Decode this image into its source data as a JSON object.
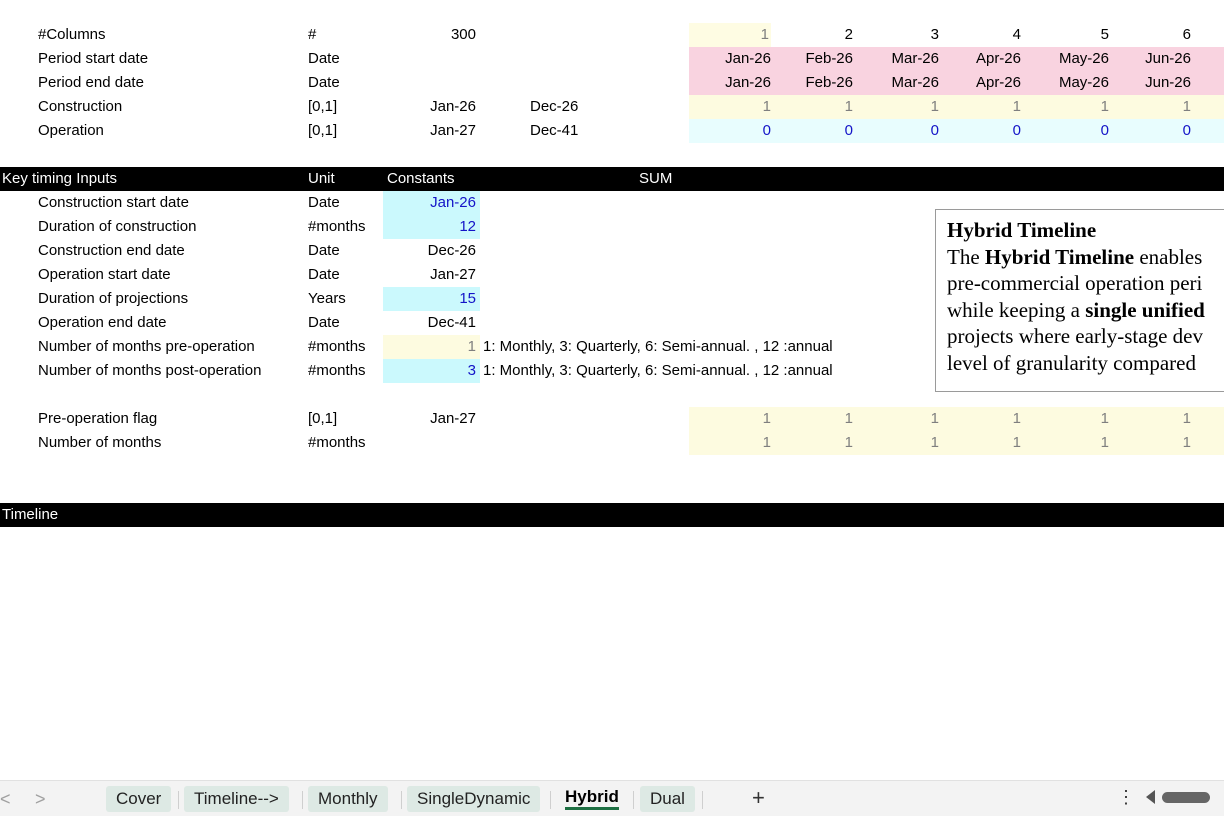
{
  "timeline_rows": [
    {
      "label": "#Columns",
      "unit": "#",
      "constant": "300",
      "start": "",
      "end": "",
      "cells": [
        "1",
        "2",
        "3",
        "4",
        "5",
        "6"
      ]
    },
    {
      "label": "Period start date",
      "unit": "Date",
      "constant": "",
      "start": "",
      "end": "",
      "cells": [
        "Jan-26",
        "Feb-26",
        "Mar-26",
        "Apr-26",
        "May-26",
        "Jun-26"
      ]
    },
    {
      "label": "Period end date",
      "unit": "Date",
      "constant": "",
      "start": "",
      "end": "",
      "cells": [
        "Jan-26",
        "Feb-26",
        "Mar-26",
        "Apr-26",
        "May-26",
        "Jun-26"
      ]
    },
    {
      "label": "Construction",
      "unit": "[0,1]",
      "constant": "Jan-26",
      "start": "Dec-26",
      "end": "",
      "cells": [
        "1",
        "1",
        "1",
        "1",
        "1",
        "1"
      ]
    },
    {
      "label": "Operation",
      "unit": "[0,1]",
      "constant": "Jan-27",
      "start": "Dec-41",
      "end": "",
      "cells": [
        "0",
        "0",
        "0",
        "0",
        "0",
        "0"
      ]
    }
  ],
  "key_timing_header": {
    "title": "Key timing Inputs",
    "unit": "Unit",
    "constants": "Constants",
    "sum": "SUM"
  },
  "key_timing_rows": [
    {
      "label": "Construction start date",
      "unit": "Date",
      "value": "Jan-26",
      "note": ""
    },
    {
      "label": "Duration of construction",
      "unit": "#months",
      "value": "12",
      "note": ""
    },
    {
      "label": "Construction end date",
      "unit": "Date",
      "value": "Dec-26",
      "note": ""
    },
    {
      "label": "Operation start date",
      "unit": "Date",
      "value": "Jan-27",
      "note": ""
    },
    {
      "label": "Duration of projections",
      "unit": "Years",
      "value": "15",
      "note": ""
    },
    {
      "label": "Operation end date",
      "unit": "Date",
      "value": "Dec-41",
      "note": ""
    },
    {
      "label": "Number of months pre-operation",
      "unit": "#months",
      "value": "1",
      "note": "1: Monthly, 3: Quarterly, 6: Semi-annual. , 12 :annual"
    },
    {
      "label": "Number of months post-operation",
      "unit": "#months",
      "value": "3",
      "note": "1: Monthly, 3: Quarterly, 6: Semi-annual. , 12 :annual"
    }
  ],
  "flag_rows": [
    {
      "label": "Pre-operation flag",
      "unit": "[0,1]",
      "constant": "Jan-27",
      "cells": [
        "1",
        "1",
        "1",
        "1",
        "1",
        "1"
      ]
    },
    {
      "label": "Number of months",
      "unit": "#months",
      "constant": "",
      "cells": [
        "1",
        "1",
        "1",
        "1",
        "1",
        "1"
      ]
    }
  ],
  "timeline_band": {
    "title": "Timeline"
  },
  "textbox": {
    "title": "Hybrid Timeline",
    "line1_a": "The ",
    "line1_b": "Hybrid Timeline",
    "line1_c": " enables",
    "line2": "pre-commercial operation peri",
    "line3_a": "while keeping a ",
    "line3_b": "single unified",
    "line4": "projects where early-stage dev",
    "line5": "level of granularity compared"
  },
  "tabs": [
    {
      "label": "Cover",
      "active": false
    },
    {
      "label": "Timeline-->",
      "active": false
    },
    {
      "label": "Monthly",
      "active": false
    },
    {
      "label": "SingleDynamic",
      "active": false
    },
    {
      "label": "Hybrid",
      "active": true
    },
    {
      "label": "Dual",
      "active": false
    }
  ],
  "tabbar": {
    "add": "+",
    "more": "⋮",
    "prev": "<",
    "next": ">"
  },
  "colors": {
    "input_cyan": "#cbf9fd",
    "date_pink": "#f9d3e0",
    "flag_yellow": "#fefce3",
    "tab_active_underline": "#1d6f42"
  }
}
